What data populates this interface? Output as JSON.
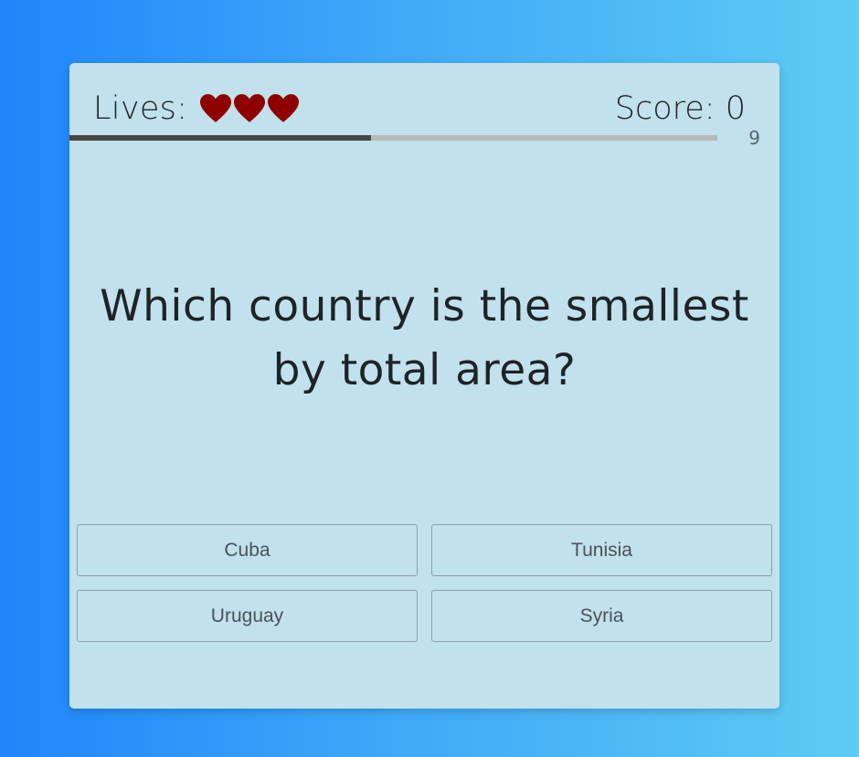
{
  "header": {
    "lives_label": "Lives:",
    "lives_count": 3,
    "score_label": "Score: 0",
    "timer_value": "9"
  },
  "progress": {
    "fraction": 0.466
  },
  "question": {
    "text": "Which country is the smallest by total area?"
  },
  "answers": [
    {
      "label": "Cuba"
    },
    {
      "label": "Tunisia"
    },
    {
      "label": "Uruguay"
    },
    {
      "label": "Syria"
    }
  ],
  "colors": {
    "heart": "#8e0000",
    "card_bg": "#c1e1ec",
    "progress_fill": "#454545",
    "progress_track": "#b9b9b9"
  }
}
